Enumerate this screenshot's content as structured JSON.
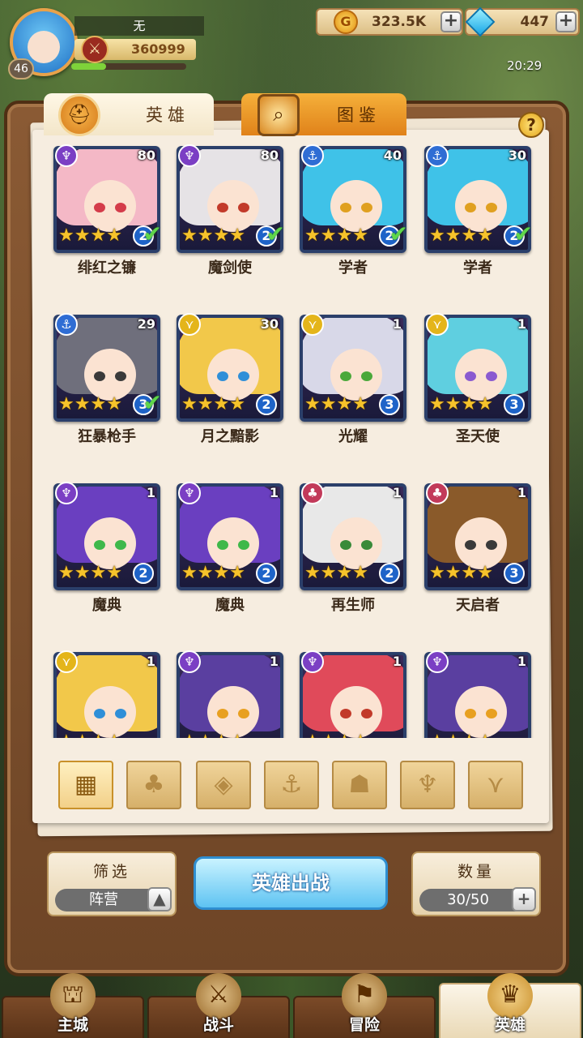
{
  "player": {
    "name": "无",
    "level": "46",
    "power": "360999",
    "exp_fraction": 0.3
  },
  "resources": {
    "gold": "323.5K",
    "gems": "447"
  },
  "time": "20:29",
  "tabs": {
    "heroes": "英雄",
    "atlas": "图鉴"
  },
  "help_label": "?",
  "heroes": [
    {
      "name": "绯红之镰",
      "level": "80",
      "tier": "2",
      "faction": "dark",
      "deployed": true,
      "hair": "#f4b8c6",
      "eye": "#d43c4a"
    },
    {
      "name": "魔剑使",
      "level": "80",
      "tier": "2",
      "faction": "dark",
      "deployed": true,
      "hair": "#e6e3e6",
      "eye": "#c23a2a"
    },
    {
      "name": "学者",
      "level": "40",
      "tier": "2",
      "faction": "water",
      "deployed": true,
      "hair": "#3fc2e8",
      "eye": "#e0a020"
    },
    {
      "name": "学者",
      "level": "30",
      "tier": "2",
      "faction": "water",
      "deployed": true,
      "hair": "#3fc2e8",
      "eye": "#e0a020"
    },
    {
      "name": "狂暴枪手",
      "level": "29",
      "tier": "3",
      "faction": "water",
      "deployed": true,
      "hair": "#6f6f7c",
      "eye": "#3a3a3a"
    },
    {
      "name": "月之黯影",
      "level": "30",
      "tier": "2",
      "faction": "light",
      "deployed": false,
      "hair": "#f2c84a",
      "eye": "#2f8fd8"
    },
    {
      "name": "光耀",
      "level": "1",
      "tier": "3",
      "faction": "light",
      "deployed": false,
      "hair": "#d8d8e8",
      "eye": "#4aa83a"
    },
    {
      "name": "圣天使",
      "level": "1",
      "tier": "3",
      "faction": "light",
      "deployed": false,
      "hair": "#5fcfe0",
      "eye": "#8a5ad0"
    },
    {
      "name": "魔典",
      "level": "1",
      "tier": "2",
      "faction": "dark",
      "deployed": false,
      "hair": "#6a3fc0",
      "eye": "#3fb84a"
    },
    {
      "name": "魔典",
      "level": "1",
      "tier": "2",
      "faction": "dark",
      "deployed": false,
      "hair": "#6a3fc0",
      "eye": "#3fb84a"
    },
    {
      "name": "再生师",
      "level": "1",
      "tier": "2",
      "faction": "fire",
      "deployed": false,
      "hair": "#e8e8e8",
      "eye": "#3a8a3a"
    },
    {
      "name": "天启者",
      "level": "1",
      "tier": "3",
      "faction": "fire",
      "deployed": false,
      "hair": "#8a5a2a",
      "eye": "#3a3a3a"
    },
    {
      "name": "",
      "level": "1",
      "tier": "",
      "faction": "light",
      "deployed": false,
      "hair": "#f2c84a",
      "eye": "#2f8fd8"
    },
    {
      "name": "",
      "level": "1",
      "tier": "",
      "faction": "dark",
      "deployed": false,
      "hair": "#5a3fa0",
      "eye": "#e8a020"
    },
    {
      "name": "",
      "level": "1",
      "tier": "",
      "faction": "dark",
      "deployed": false,
      "hair": "#e04a5a",
      "eye": "#c23a2a"
    },
    {
      "name": "",
      "level": "1",
      "tier": "",
      "faction": "dark",
      "deployed": false,
      "hair": "#5a3fa0",
      "eye": "#e8a020"
    }
  ],
  "faction_filters": [
    {
      "icon": "all-grid-icon",
      "glyph": "▦",
      "active": true
    },
    {
      "icon": "nature-faction-icon",
      "glyph": "♣",
      "active": false
    },
    {
      "icon": "diamond-faction-icon",
      "glyph": "◈",
      "active": false
    },
    {
      "icon": "anchor-faction-icon",
      "glyph": "⚓",
      "active": false
    },
    {
      "icon": "beast-faction-icon",
      "glyph": "☗",
      "active": false
    },
    {
      "icon": "horned-faction-icon",
      "glyph": "♆",
      "active": false
    },
    {
      "icon": "wing-faction-icon",
      "glyph": "⋎",
      "active": false
    }
  ],
  "filter": {
    "label": "筛选",
    "value": "阵营"
  },
  "deploy_label": "英雄出战",
  "count": {
    "label": "数量",
    "value": "30/50"
  },
  "nav": [
    {
      "label": "主城",
      "icon": "city-icon",
      "active": false
    },
    {
      "label": "战斗",
      "icon": "swords-icon",
      "active": false
    },
    {
      "label": "冒险",
      "icon": "map-icon",
      "active": false
    },
    {
      "label": "英雄",
      "icon": "hero-crest-icon",
      "active": true
    }
  ],
  "colors": {
    "dark": "#7b3fc4",
    "water": "#2f6dd4",
    "light": "#e4b51a",
    "fire": "#c23a5a"
  }
}
